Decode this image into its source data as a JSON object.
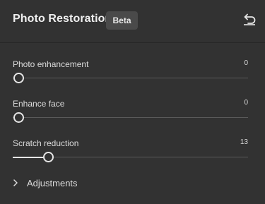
{
  "panel": {
    "title": "Photo Restoration",
    "badge": "Beta",
    "reset_icon": "reset-undo-icon",
    "bg_color": "#323232",
    "accent_color": "#e6e6e6"
  },
  "sliders": [
    {
      "label": "Photo enhancement",
      "value": "0",
      "min": 0,
      "max": 100,
      "level": 0
    },
    {
      "label": "Enhance face",
      "value": "0",
      "min": 0,
      "max": 100,
      "level": 0
    },
    {
      "label": "Scratch reduction",
      "value": "13",
      "min": 0,
      "max": 100,
      "level": 13
    }
  ],
  "sections": [
    {
      "label": "Adjustments",
      "expanded": false,
      "icon": "chevron-right-icon"
    }
  ]
}
